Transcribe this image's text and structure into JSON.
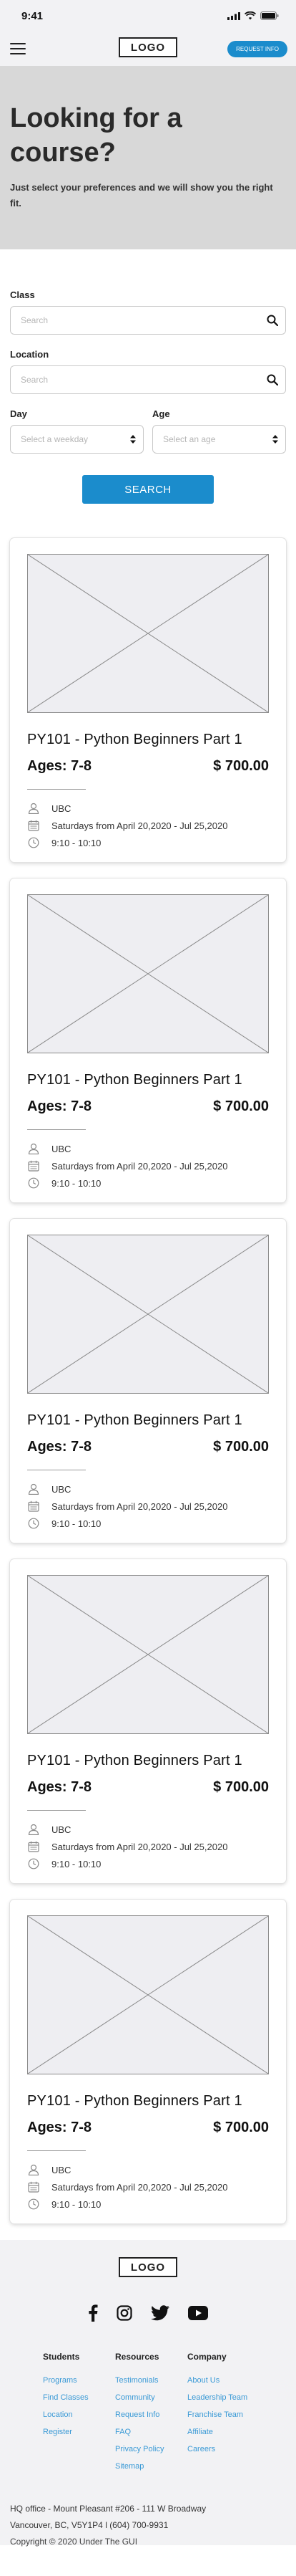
{
  "status": {
    "time": "9:41"
  },
  "header": {
    "logo": "LOGO",
    "request_info": "REQUEST INFO"
  },
  "hero": {
    "title": "Looking for a course?",
    "subtitle": "Just select your preferences and we will show you the right fit."
  },
  "filters": {
    "class_label": "Class",
    "class_placeholder": "Search",
    "location_label": "Location",
    "location_placeholder": "Search",
    "day_label": "Day",
    "day_value": "Select a weekday",
    "age_label": "Age",
    "age_value": "Select an age",
    "search_button": "SEARCH"
  },
  "courses": [
    {
      "title": "PY101 - Python Beginners Part 1",
      "ages": "Ages: 7-8",
      "price": "$ 700.00",
      "location": "UBC",
      "schedule": "Saturdays from April 20,2020 - Jul 25,2020",
      "time": "9:10 - 10:10"
    },
    {
      "title": "PY101 - Python Beginners Part 1",
      "ages": "Ages: 7-8",
      "price": "$ 700.00",
      "location": "UBC",
      "schedule": "Saturdays from April 20,2020 - Jul 25,2020",
      "time": "9:10 - 10:10"
    },
    {
      "title": "PY101 - Python Beginners Part 1",
      "ages": "Ages: 7-8",
      "price": "$ 700.00",
      "location": "UBC",
      "schedule": "Saturdays from April 20,2020 - Jul 25,2020",
      "time": "9:10 - 10:10"
    },
    {
      "title": "PY101 - Python Beginners Part 1",
      "ages": "Ages: 7-8",
      "price": "$ 700.00",
      "location": "UBC",
      "schedule": "Saturdays from April 20,2020 - Jul 25,2020",
      "time": "9:10 - 10:10"
    },
    {
      "title": "PY101 - Python Beginners Part 1",
      "ages": "Ages: 7-8",
      "price": "$ 700.00",
      "location": "UBC",
      "schedule": "Saturdays from April 20,2020 - Jul 25,2020",
      "time": "9:10 - 10:10"
    }
  ],
  "footer": {
    "logo": "LOGO",
    "socials": [
      "facebook-icon",
      "instagram-icon",
      "twitter-icon",
      "youtube-icon"
    ],
    "columns": [
      {
        "heading": "Students",
        "links": [
          "Programs",
          "Find Classes",
          "Location",
          "Register"
        ]
      },
      {
        "heading": "Resources",
        "links": [
          "Testimonials",
          "Community",
          "Request Info",
          "FAQ",
          "Privacy Policy",
          "Sitemap"
        ]
      },
      {
        "heading": "Company",
        "links": [
          "About Us",
          "Leadership Team",
          "Franchise Team",
          "Affiliate",
          "Careers"
        ]
      }
    ],
    "hq_line1": "HQ office - Mount Pleasant #206 - 111 W Broadway",
    "hq_line2": "Vancouver, BC, V5Y1P4 l (604) 700-9931",
    "copyright": "Copyright © 2020 Under The GUI"
  },
  "colors": {
    "accent": "#1b8ccc",
    "link": "#3a9ad6",
    "hero_bg": "#d8d8d8",
    "header_bg": "#f2f2f4"
  }
}
